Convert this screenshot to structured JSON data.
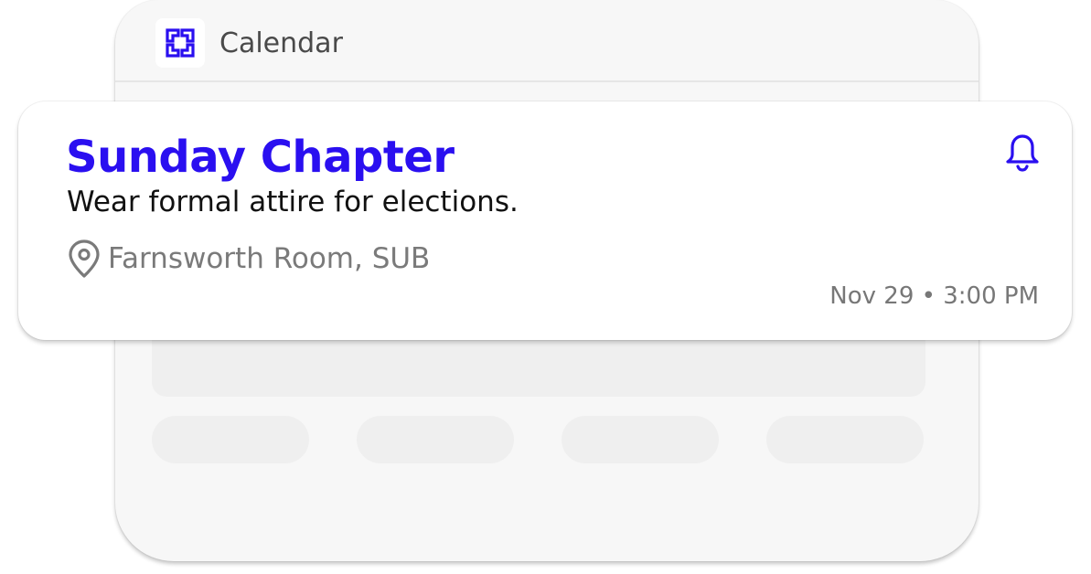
{
  "app": {
    "title": "Calendar",
    "logo_icon": "greek-key-logo-icon"
  },
  "notification": {
    "title": "Sunday Chapter",
    "message": "Wear formal attire for elections.",
    "location": "Farnsworth Room, SUB",
    "date": "Nov 29",
    "time": "3:00 PM",
    "separator": "•",
    "icons": {
      "location": "location-pin-icon",
      "alert": "bell-icon"
    }
  },
  "colors": {
    "accent": "#2a0ff0",
    "muted_text": "#7a7a7a",
    "placeholder": "#efefef"
  }
}
